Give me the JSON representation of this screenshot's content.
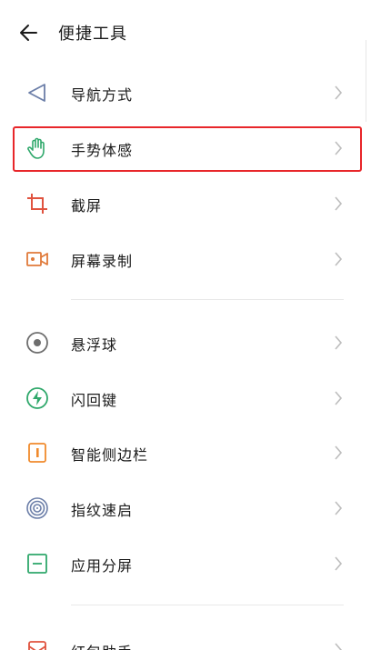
{
  "header": {
    "title": "便捷工具",
    "back_icon": "back-arrow-icon"
  },
  "accent": {
    "highlight": "#e8262a"
  },
  "items": [
    {
      "label": "导航方式",
      "icon": "navigation-triangle-icon",
      "color": "#6b7ea8"
    },
    {
      "label": "手势体感",
      "icon": "hand-gesture-icon",
      "color": "#2fa86b"
    },
    {
      "label": "截屏",
      "icon": "crop-icon",
      "color": "#e0533f"
    },
    {
      "label": "屏幕录制",
      "icon": "video-camera-icon",
      "color": "#e07a3a"
    },
    {
      "label": "悬浮球",
      "icon": "floating-ball-icon",
      "color": "#6e6e6e"
    },
    {
      "label": "闪回键",
      "icon": "flash-icon",
      "color": "#2fa86b"
    },
    {
      "label": "智能侧边栏",
      "icon": "sidebar-icon",
      "color": "#f08a2c"
    },
    {
      "label": "指纹速启",
      "icon": "fingerprint-icon",
      "color": "#6b7ea8"
    },
    {
      "label": "应用分屏",
      "icon": "split-screen-icon",
      "color": "#2fa86b"
    },
    {
      "label": "红包助手",
      "icon": "red-envelope-icon",
      "color": "#e0533f"
    }
  ]
}
